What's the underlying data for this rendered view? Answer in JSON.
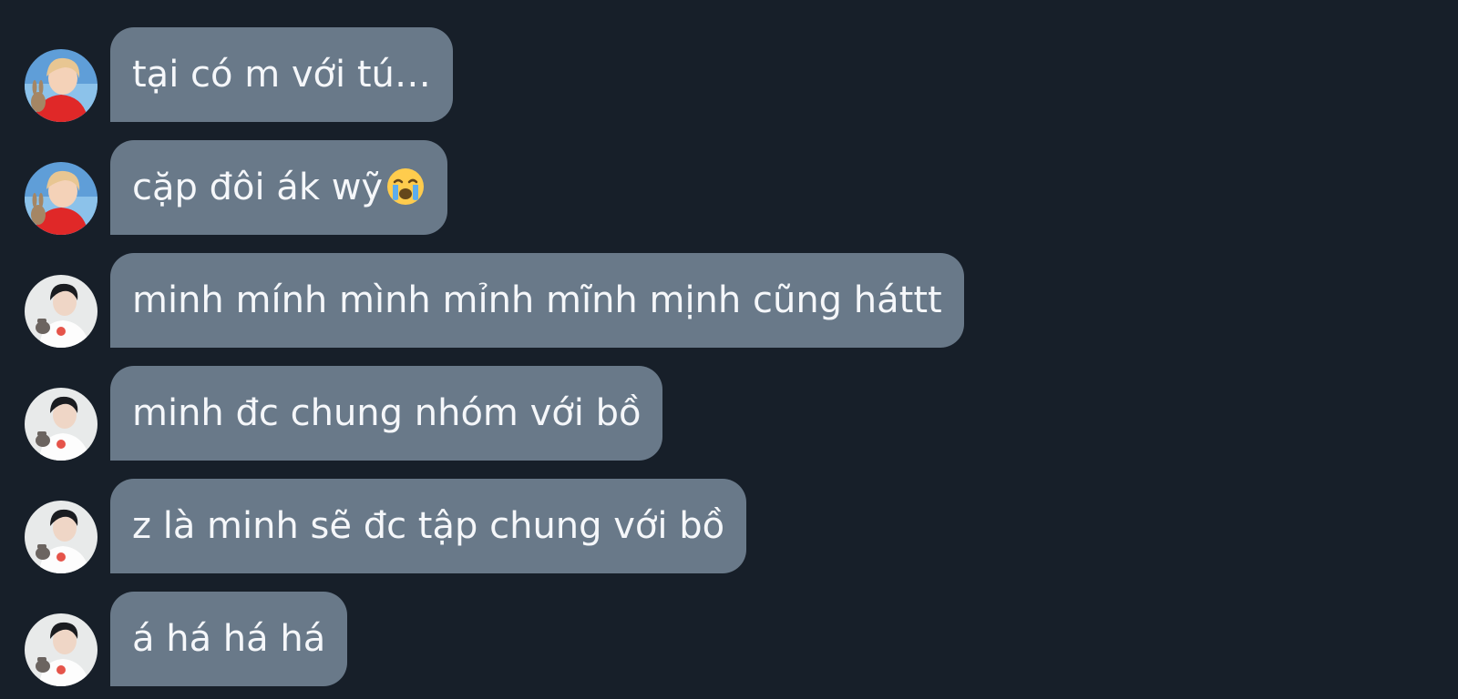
{
  "colors": {
    "background": "#171f29",
    "bubble": "#697989",
    "text": "#f5f7fa"
  },
  "messages": [
    {
      "text": "tại có m với tú…",
      "avatar": "blonde-user-avatar"
    },
    {
      "text": "cặp đôi ák wỹ",
      "emoji": "loudly-crying-face-icon",
      "avatar": "blonde-user-avatar"
    },
    {
      "text": "minh mính mình mỉnh mĩnh mịnh cũng háttt",
      "avatar": "dark-haired-user-avatar"
    },
    {
      "text": "minh đc chung nhóm với bồ",
      "avatar": "dark-haired-user-avatar"
    },
    {
      "text": "z là minh sẽ đc tập chung với bồ",
      "avatar": "dark-haired-user-avatar"
    },
    {
      "text": "á há há há",
      "avatar": "dark-haired-user-avatar"
    }
  ]
}
